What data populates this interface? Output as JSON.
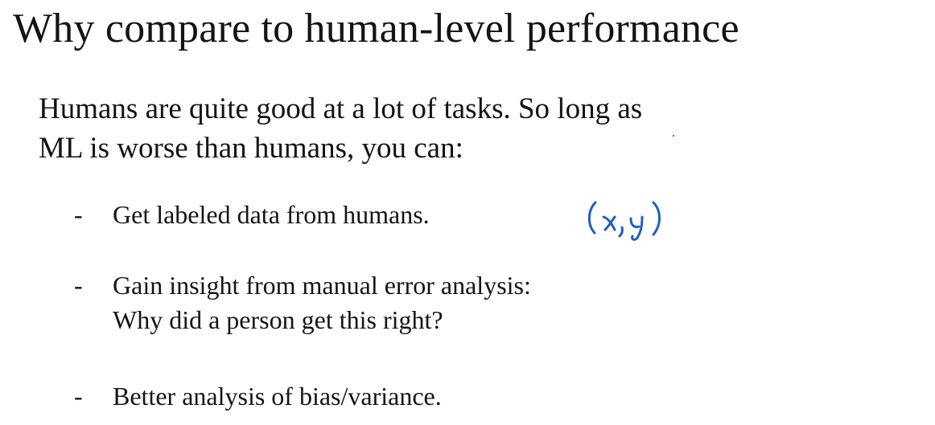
{
  "slide": {
    "title": "Why compare to human-level performance",
    "intro_lines": [
      "Humans are quite good at a lot of tasks. So long as",
      "ML is worse than humans, you can:"
    ],
    "bullets": [
      {
        "marker": "-",
        "lines": [
          "Get labeled data from humans."
        ]
      },
      {
        "marker": "-",
        "lines": [
          "Gain insight from manual error analysis:",
          "Why did a person get this right?"
        ]
      },
      {
        "marker": "-",
        "lines": [
          "Better analysis of bias/variance."
        ]
      }
    ],
    "handwritten_annotation": "(x,y)",
    "colors": {
      "text": "#141414",
      "ink": "#1f5fbf",
      "background": "#ffffff"
    }
  }
}
